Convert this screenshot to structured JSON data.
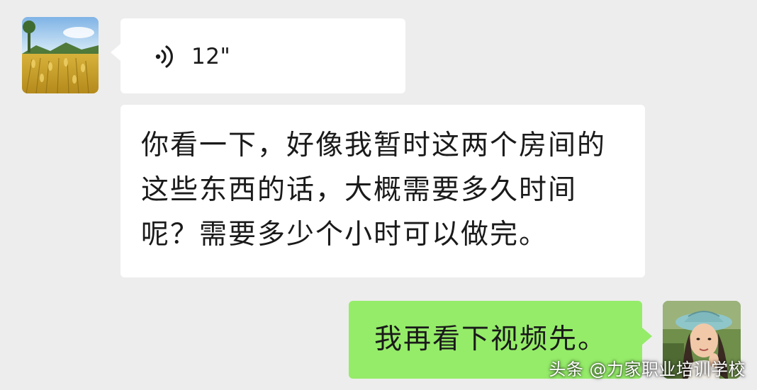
{
  "chat": {
    "incoming": {
      "voice_duration": "12\"",
      "text": "你看一下，好像我暂时这两个房间的这些东西的话，大概需要多久时间呢？需要多少个小时可以做完。"
    },
    "outgoing": {
      "text": "我再看下视频先。"
    }
  },
  "icons": {
    "voice": "voice-wave-icon",
    "contact_avatar": "rice-field-avatar",
    "self_avatar": "woman-in-hat-avatar"
  },
  "colors": {
    "background": "#ededed",
    "incoming_bubble": "#ffffff",
    "outgoing_bubble": "#95ec69"
  },
  "watermark": "头条 @力家职业培训学校"
}
